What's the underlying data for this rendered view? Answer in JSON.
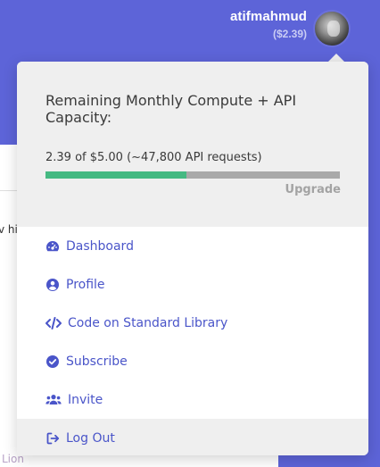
{
  "header": {
    "username": "atifmahmud",
    "balance": "($2.39)"
  },
  "background": {
    "peek_text": "v hi",
    "peek_footer": "Lion"
  },
  "capacity": {
    "title": "Remaining Monthly Compute + API Capacity:",
    "usage": "2.39 of $5.00 (~47,800 API requests)",
    "progress_fraction": 0.478,
    "upgrade_label": "Upgrade"
  },
  "menu": {
    "items": [
      {
        "label": "Dashboard",
        "icon": "dashboard-icon"
      },
      {
        "label": "Profile",
        "icon": "user-circle-icon"
      },
      {
        "label": "Code on Standard Library",
        "icon": "code-icon"
      },
      {
        "label": "Subscribe",
        "icon": "check-circle-icon"
      },
      {
        "label": "Invite",
        "icon": "users-icon"
      },
      {
        "label": "Log Out",
        "icon": "sign-out-icon"
      }
    ]
  },
  "colors": {
    "header_bg": "#5d64d8",
    "menu_text": "#4a55c9",
    "progress_fill": "#45b982",
    "progress_track": "#a9a9a9"
  }
}
